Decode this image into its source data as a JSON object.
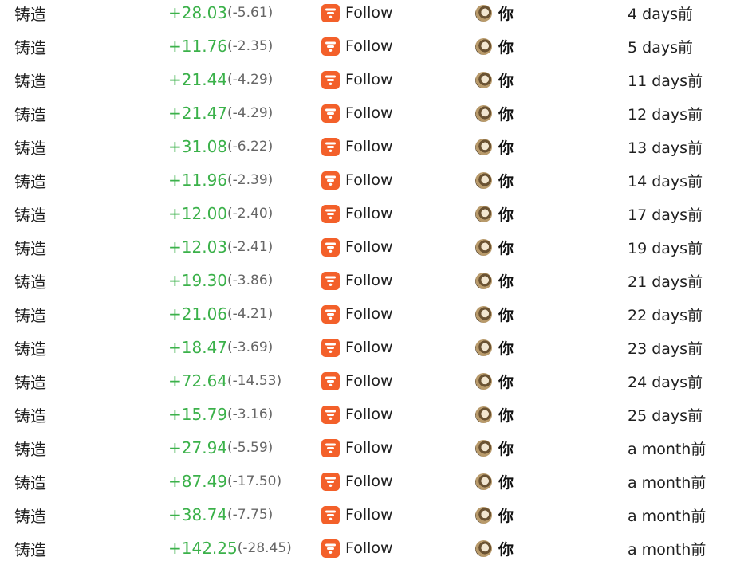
{
  "colors": {
    "amount_positive": "#3bb14a",
    "fee_text": "#666666",
    "source_logo": "#f3602a"
  },
  "icons": {
    "source_logo": "follow-logo-icon",
    "user_avatar": "avatar-icon"
  },
  "rows": [
    {
      "type": "铸造",
      "amount": "+28.03",
      "fee": "(-5.61)",
      "source": "Follow",
      "user": "你",
      "time": "4 days前"
    },
    {
      "type": "铸造",
      "amount": "+11.76",
      "fee": "(-2.35)",
      "source": "Follow",
      "user": "你",
      "time": "5 days前"
    },
    {
      "type": "铸造",
      "amount": "+21.44",
      "fee": "(-4.29)",
      "source": "Follow",
      "user": "你",
      "time": "11 days前"
    },
    {
      "type": "铸造",
      "amount": "+21.47",
      "fee": "(-4.29)",
      "source": "Follow",
      "user": "你",
      "time": "12 days前"
    },
    {
      "type": "铸造",
      "amount": "+31.08",
      "fee": "(-6.22)",
      "source": "Follow",
      "user": "你",
      "time": "13 days前"
    },
    {
      "type": "铸造",
      "amount": "+11.96",
      "fee": "(-2.39)",
      "source": "Follow",
      "user": "你",
      "time": "14 days前"
    },
    {
      "type": "铸造",
      "amount": "+12.00",
      "fee": "(-2.40)",
      "source": "Follow",
      "user": "你",
      "time": "17 days前"
    },
    {
      "type": "铸造",
      "amount": "+12.03",
      "fee": "(-2.41)",
      "source": "Follow",
      "user": "你",
      "time": "19 days前"
    },
    {
      "type": "铸造",
      "amount": "+19.30",
      "fee": "(-3.86)",
      "source": "Follow",
      "user": "你",
      "time": "21 days前"
    },
    {
      "type": "铸造",
      "amount": "+21.06",
      "fee": "(-4.21)",
      "source": "Follow",
      "user": "你",
      "time": "22 days前"
    },
    {
      "type": "铸造",
      "amount": "+18.47",
      "fee": "(-3.69)",
      "source": "Follow",
      "user": "你",
      "time": "23 days前"
    },
    {
      "type": "铸造",
      "amount": "+72.64",
      "fee": "(-14.53)",
      "source": "Follow",
      "user": "你",
      "time": "24 days前"
    },
    {
      "type": "铸造",
      "amount": "+15.79",
      "fee": "(-3.16)",
      "source": "Follow",
      "user": "你",
      "time": "25 days前"
    },
    {
      "type": "铸造",
      "amount": "+27.94",
      "fee": "(-5.59)",
      "source": "Follow",
      "user": "你",
      "time": "a month前"
    },
    {
      "type": "铸造",
      "amount": "+87.49",
      "fee": "(-17.50)",
      "source": "Follow",
      "user": "你",
      "time": "a month前"
    },
    {
      "type": "铸造",
      "amount": "+38.74",
      "fee": "(-7.75)",
      "source": "Follow",
      "user": "你",
      "time": "a month前"
    },
    {
      "type": "铸造",
      "amount": "+142.25",
      "fee": "(-28.45)",
      "source": "Follow",
      "user": "你",
      "time": "a month前"
    }
  ]
}
